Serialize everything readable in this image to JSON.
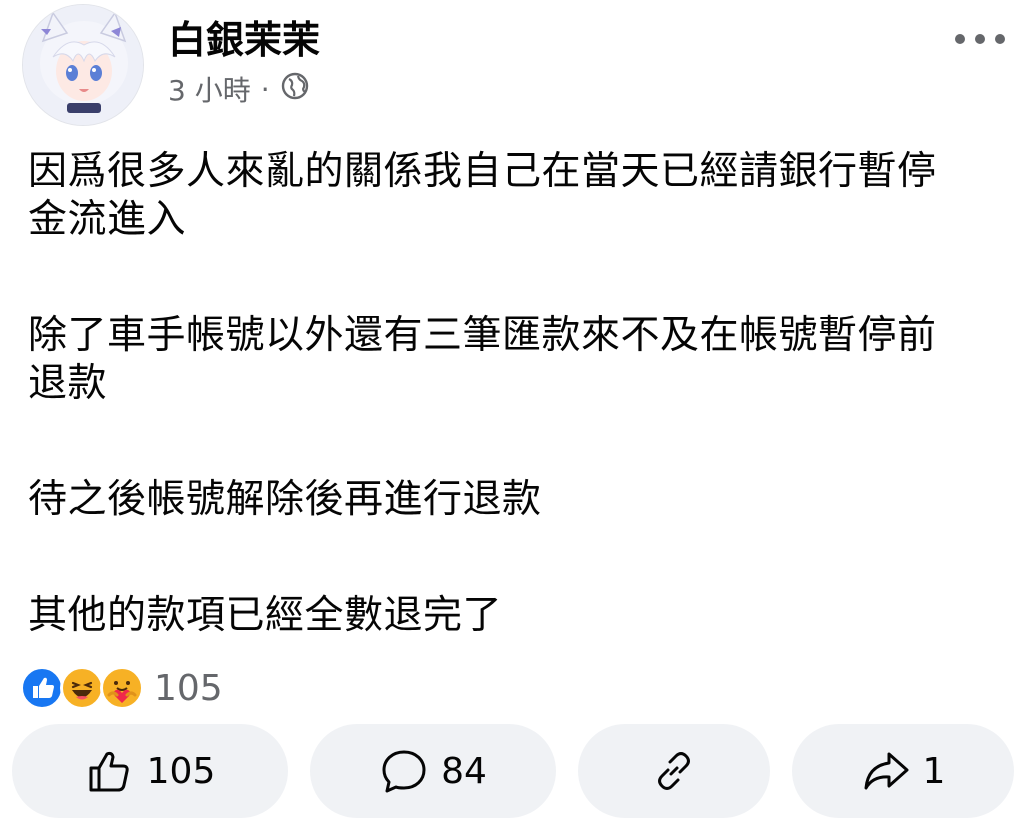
{
  "post": {
    "author": "白銀茉茉",
    "time": "3 小時",
    "separator": "·",
    "paragraphs": [
      "因爲很多人來亂的關係我自己在當天已經請銀行暫停\n金流進入",
      "除了車手帳號以外還有三筆匯款來不及在帳號暫停前\n退款",
      "待之後帳號解除後再進行退款",
      "其他的款項已經全數退完了"
    ]
  },
  "reactions": {
    "icons": [
      "like-reaction",
      "haha-reaction",
      "care-reaction"
    ],
    "count": "105"
  },
  "actions": {
    "like_count": "105",
    "comment_count": "84",
    "share_count": "1"
  },
  "colors": {
    "like_blue": "#1877f2",
    "haha_yellow": "#f7b125",
    "secondary_text": "#65676b",
    "pill_bg": "#f0f2f5"
  }
}
